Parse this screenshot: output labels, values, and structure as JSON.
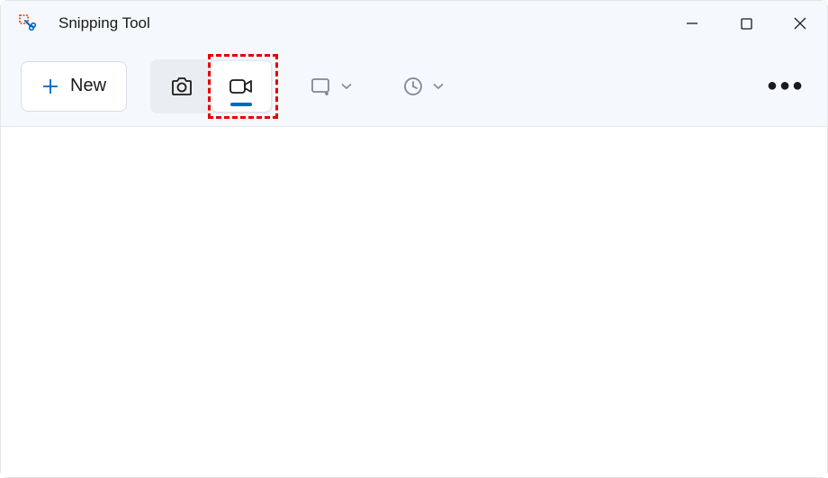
{
  "titlebar": {
    "app_title": "Snipping Tool"
  },
  "toolbar": {
    "new_label": "New",
    "modes": {
      "snip": "Snip",
      "record": "Record",
      "active": "record"
    },
    "shape_dropdown": "Rectangle mode",
    "delay_dropdown": "No delay",
    "more_label": "See more"
  },
  "window_controls": {
    "minimize": "Minimize",
    "maximize": "Maximize",
    "close": "Close"
  },
  "highlight": {
    "target": "record-mode-button"
  }
}
